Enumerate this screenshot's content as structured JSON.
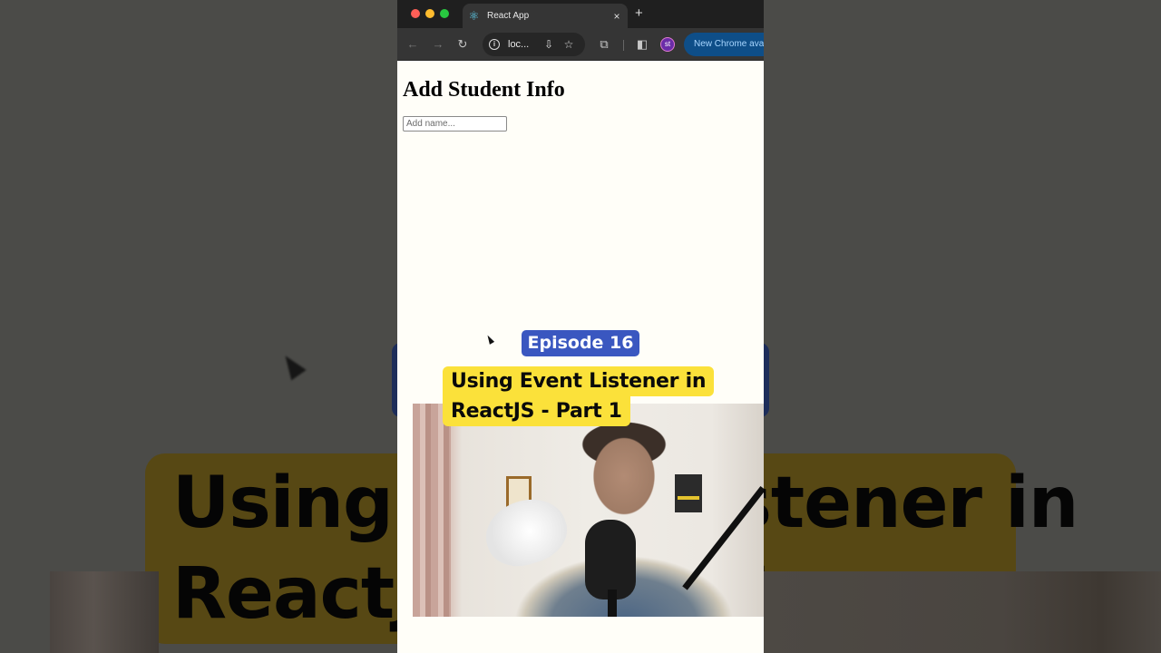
{
  "background": {
    "title_text": "Using Event Listener in\nReactJS - Part 1",
    "overlay_color": "#4b4b48"
  },
  "browser": {
    "tab": {
      "title": "React App",
      "favicon": "react-logo-icon",
      "close_label": "×"
    },
    "new_tab_label": "+",
    "toolbar": {
      "back_icon": "←",
      "forward_icon": "→",
      "reload_icon": "↻",
      "url": "loc...",
      "info_icon": "i",
      "install_icon": "⇩",
      "bookmark_icon": "☆",
      "extensions_icon": "⧉",
      "sidepanel_icon": "◧",
      "profile_initials": "st",
      "update_label": "New Chrome available"
    }
  },
  "page": {
    "heading": "Add Student Info",
    "name_input": {
      "value": "",
      "placeholder": "Add name..."
    }
  },
  "overlay": {
    "episode_label": "Episode 16",
    "title_line1": "Using Event Listener in",
    "title_line2": "ReactJS - Part 1",
    "colors": {
      "episode_badge": "#3a57c0",
      "title_highlight": "#fbe13a"
    }
  }
}
